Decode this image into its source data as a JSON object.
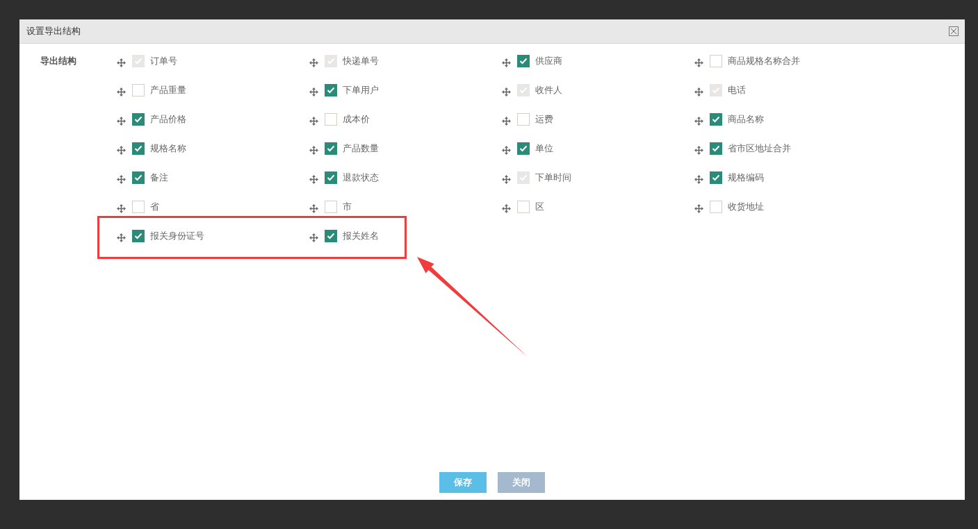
{
  "dialog": {
    "title": "设置导出结构",
    "section_label": "导出结构",
    "fields": [
      {
        "label": "订单号",
        "checked": true,
        "disabled": true
      },
      {
        "label": "快递单号",
        "checked": true,
        "disabled": true
      },
      {
        "label": "供应商",
        "checked": true,
        "disabled": false
      },
      {
        "label": "商品规格名称合并",
        "checked": false,
        "disabled": false
      },
      {
        "label": "产品重量",
        "checked": false,
        "disabled": false
      },
      {
        "label": "下单用户",
        "checked": true,
        "disabled": false
      },
      {
        "label": "收件人",
        "checked": true,
        "disabled": true
      },
      {
        "label": "电话",
        "checked": true,
        "disabled": true
      },
      {
        "label": "产品价格",
        "checked": true,
        "disabled": false
      },
      {
        "label": "成本价",
        "checked": false,
        "disabled": false
      },
      {
        "label": "运费",
        "checked": false,
        "disabled": false
      },
      {
        "label": "商品名称",
        "checked": true,
        "disabled": false
      },
      {
        "label": "规格名称",
        "checked": true,
        "disabled": false
      },
      {
        "label": "产品数量",
        "checked": true,
        "disabled": false
      },
      {
        "label": "单位",
        "checked": true,
        "disabled": false
      },
      {
        "label": "省市区地址合并",
        "checked": true,
        "disabled": false
      },
      {
        "label": "备注",
        "checked": true,
        "disabled": false
      },
      {
        "label": "退款状态",
        "checked": true,
        "disabled": false
      },
      {
        "label": "下单时间",
        "checked": true,
        "disabled": true
      },
      {
        "label": "规格编码",
        "checked": true,
        "disabled": false
      },
      {
        "label": "省",
        "checked": false,
        "disabled": false
      },
      {
        "label": "市",
        "checked": false,
        "disabled": false
      },
      {
        "label": "区",
        "checked": false,
        "disabled": false
      },
      {
        "label": "收货地址",
        "checked": false,
        "disabled": false
      },
      {
        "label": "报关身份证号",
        "checked": true,
        "disabled": false
      },
      {
        "label": "报关姓名",
        "checked": true,
        "disabled": false
      }
    ],
    "buttons": [
      {
        "label": "保存",
        "kind": "primary"
      },
      {
        "label": "关闭",
        "kind": "secondary"
      }
    ]
  }
}
